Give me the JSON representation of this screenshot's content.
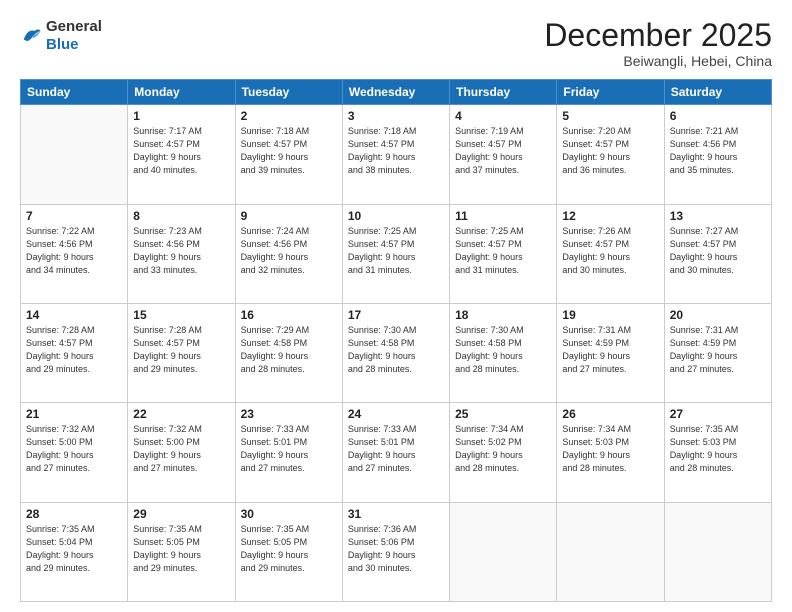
{
  "logo": {
    "general": "General",
    "blue": "Blue"
  },
  "header": {
    "month": "December 2025",
    "location": "Beiwangli, Hebei, China"
  },
  "weekdays": [
    "Sunday",
    "Monday",
    "Tuesday",
    "Wednesday",
    "Thursday",
    "Friday",
    "Saturday"
  ],
  "weeks": [
    [
      {
        "day": "",
        "info": ""
      },
      {
        "day": "1",
        "info": "Sunrise: 7:17 AM\nSunset: 4:57 PM\nDaylight: 9 hours\nand 40 minutes."
      },
      {
        "day": "2",
        "info": "Sunrise: 7:18 AM\nSunset: 4:57 PM\nDaylight: 9 hours\nand 39 minutes."
      },
      {
        "day": "3",
        "info": "Sunrise: 7:18 AM\nSunset: 4:57 PM\nDaylight: 9 hours\nand 38 minutes."
      },
      {
        "day": "4",
        "info": "Sunrise: 7:19 AM\nSunset: 4:57 PM\nDaylight: 9 hours\nand 37 minutes."
      },
      {
        "day": "5",
        "info": "Sunrise: 7:20 AM\nSunset: 4:57 PM\nDaylight: 9 hours\nand 36 minutes."
      },
      {
        "day": "6",
        "info": "Sunrise: 7:21 AM\nSunset: 4:56 PM\nDaylight: 9 hours\nand 35 minutes."
      }
    ],
    [
      {
        "day": "7",
        "info": "Sunrise: 7:22 AM\nSunset: 4:56 PM\nDaylight: 9 hours\nand 34 minutes."
      },
      {
        "day": "8",
        "info": "Sunrise: 7:23 AM\nSunset: 4:56 PM\nDaylight: 9 hours\nand 33 minutes."
      },
      {
        "day": "9",
        "info": "Sunrise: 7:24 AM\nSunset: 4:56 PM\nDaylight: 9 hours\nand 32 minutes."
      },
      {
        "day": "10",
        "info": "Sunrise: 7:25 AM\nSunset: 4:57 PM\nDaylight: 9 hours\nand 31 minutes."
      },
      {
        "day": "11",
        "info": "Sunrise: 7:25 AM\nSunset: 4:57 PM\nDaylight: 9 hours\nand 31 minutes."
      },
      {
        "day": "12",
        "info": "Sunrise: 7:26 AM\nSunset: 4:57 PM\nDaylight: 9 hours\nand 30 minutes."
      },
      {
        "day": "13",
        "info": "Sunrise: 7:27 AM\nSunset: 4:57 PM\nDaylight: 9 hours\nand 30 minutes."
      }
    ],
    [
      {
        "day": "14",
        "info": "Sunrise: 7:28 AM\nSunset: 4:57 PM\nDaylight: 9 hours\nand 29 minutes."
      },
      {
        "day": "15",
        "info": "Sunrise: 7:28 AM\nSunset: 4:57 PM\nDaylight: 9 hours\nand 29 minutes."
      },
      {
        "day": "16",
        "info": "Sunrise: 7:29 AM\nSunset: 4:58 PM\nDaylight: 9 hours\nand 28 minutes."
      },
      {
        "day": "17",
        "info": "Sunrise: 7:30 AM\nSunset: 4:58 PM\nDaylight: 9 hours\nand 28 minutes."
      },
      {
        "day": "18",
        "info": "Sunrise: 7:30 AM\nSunset: 4:58 PM\nDaylight: 9 hours\nand 28 minutes."
      },
      {
        "day": "19",
        "info": "Sunrise: 7:31 AM\nSunset: 4:59 PM\nDaylight: 9 hours\nand 27 minutes."
      },
      {
        "day": "20",
        "info": "Sunrise: 7:31 AM\nSunset: 4:59 PM\nDaylight: 9 hours\nand 27 minutes."
      }
    ],
    [
      {
        "day": "21",
        "info": "Sunrise: 7:32 AM\nSunset: 5:00 PM\nDaylight: 9 hours\nand 27 minutes."
      },
      {
        "day": "22",
        "info": "Sunrise: 7:32 AM\nSunset: 5:00 PM\nDaylight: 9 hours\nand 27 minutes."
      },
      {
        "day": "23",
        "info": "Sunrise: 7:33 AM\nSunset: 5:01 PM\nDaylight: 9 hours\nand 27 minutes."
      },
      {
        "day": "24",
        "info": "Sunrise: 7:33 AM\nSunset: 5:01 PM\nDaylight: 9 hours\nand 27 minutes."
      },
      {
        "day": "25",
        "info": "Sunrise: 7:34 AM\nSunset: 5:02 PM\nDaylight: 9 hours\nand 28 minutes."
      },
      {
        "day": "26",
        "info": "Sunrise: 7:34 AM\nSunset: 5:03 PM\nDaylight: 9 hours\nand 28 minutes."
      },
      {
        "day": "27",
        "info": "Sunrise: 7:35 AM\nSunset: 5:03 PM\nDaylight: 9 hours\nand 28 minutes."
      }
    ],
    [
      {
        "day": "28",
        "info": "Sunrise: 7:35 AM\nSunset: 5:04 PM\nDaylight: 9 hours\nand 29 minutes."
      },
      {
        "day": "29",
        "info": "Sunrise: 7:35 AM\nSunset: 5:05 PM\nDaylight: 9 hours\nand 29 minutes."
      },
      {
        "day": "30",
        "info": "Sunrise: 7:35 AM\nSunset: 5:05 PM\nDaylight: 9 hours\nand 29 minutes."
      },
      {
        "day": "31",
        "info": "Sunrise: 7:36 AM\nSunset: 5:06 PM\nDaylight: 9 hours\nand 30 minutes."
      },
      {
        "day": "",
        "info": ""
      },
      {
        "day": "",
        "info": ""
      },
      {
        "day": "",
        "info": ""
      }
    ]
  ]
}
